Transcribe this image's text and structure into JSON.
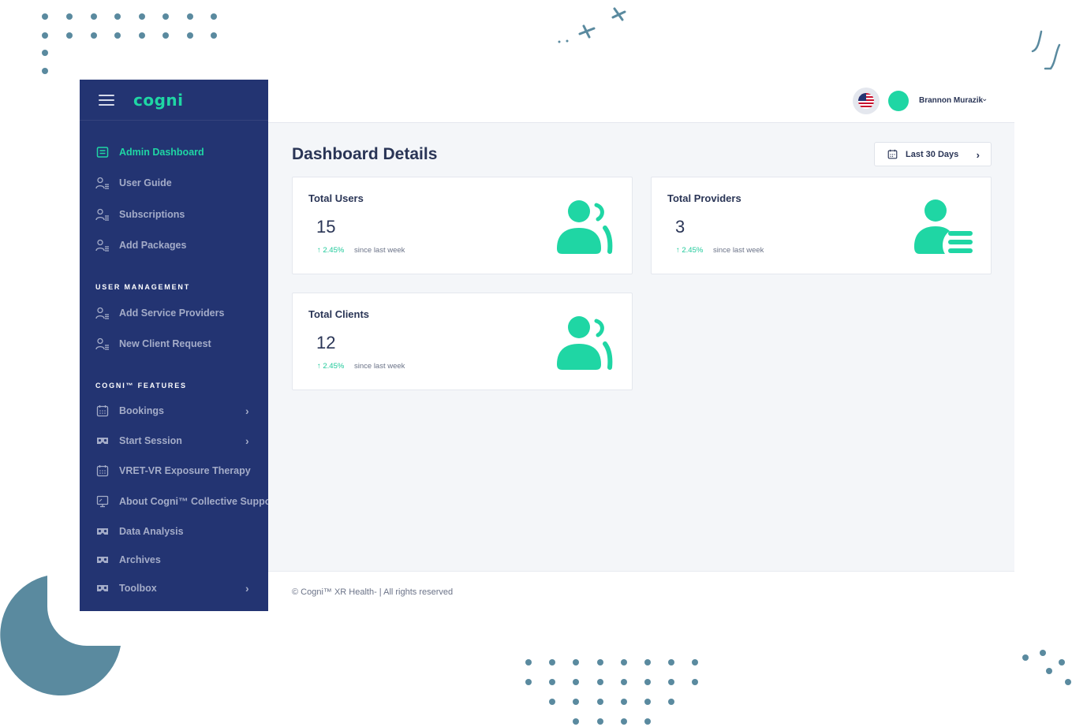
{
  "brand": {
    "logo_text": "cogni"
  },
  "sidebar": {
    "items": [
      {
        "label": "Admin Dashboard",
        "icon": "dashboard-icon"
      },
      {
        "label": "User Guide",
        "icon": "user-list-icon"
      },
      {
        "label": "Subscriptions",
        "icon": "user-list-icon"
      },
      {
        "label": "Add Packages",
        "icon": "user-list-icon"
      }
    ],
    "sections": [
      {
        "title": "USER MANAGEMENT",
        "items": [
          {
            "label": "Add Service Providers",
            "icon": "user-list-icon"
          },
          {
            "label": "New Client Request",
            "icon": "user-list-icon"
          }
        ]
      },
      {
        "title": "COGNI™ FEATURES",
        "items": [
          {
            "label": "Bookings",
            "icon": "calendar-icon",
            "has_submenu": true
          },
          {
            "label": "Start Session",
            "icon": "vr-headset-icon",
            "has_submenu": true
          },
          {
            "label": "VRET-VR Exposure Therapy",
            "icon": "calendar-icon"
          },
          {
            "label": "About Cogni™ Collective Support",
            "icon": "monitor-icon"
          },
          {
            "label": "Data Analysis",
            "icon": "vr-headset-icon"
          },
          {
            "label": "Archives",
            "icon": "vr-headset-icon"
          },
          {
            "label": "Toolbox",
            "icon": "vr-headset-icon",
            "has_submenu": true
          }
        ]
      }
    ]
  },
  "header": {
    "user_name": "Brannon Murazik",
    "language_flag": "us-flag-icon"
  },
  "main": {
    "title": "Dashboard Details",
    "date_range": "Last 30 Days",
    "cards": [
      {
        "title": "Total Users",
        "value": "15",
        "delta": "↑ 2.45%",
        "since": "since last week",
        "icon": "users-icon"
      },
      {
        "title": "Total Providers",
        "value": "3",
        "delta": "↑ 2.45%",
        "since": "since last week",
        "icon": "provider-list-icon"
      },
      {
        "title": "Total Clients",
        "value": "12",
        "delta": "↑ 2.45%",
        "since": "since last week",
        "icon": "users-icon"
      }
    ]
  },
  "footer": {
    "text": "© Cogni™ XR Health- | All rights reserved"
  },
  "colors": {
    "accent": "#1fd6a4",
    "sidebar_bg": "#233472",
    "decor": "#5a8a9f"
  }
}
